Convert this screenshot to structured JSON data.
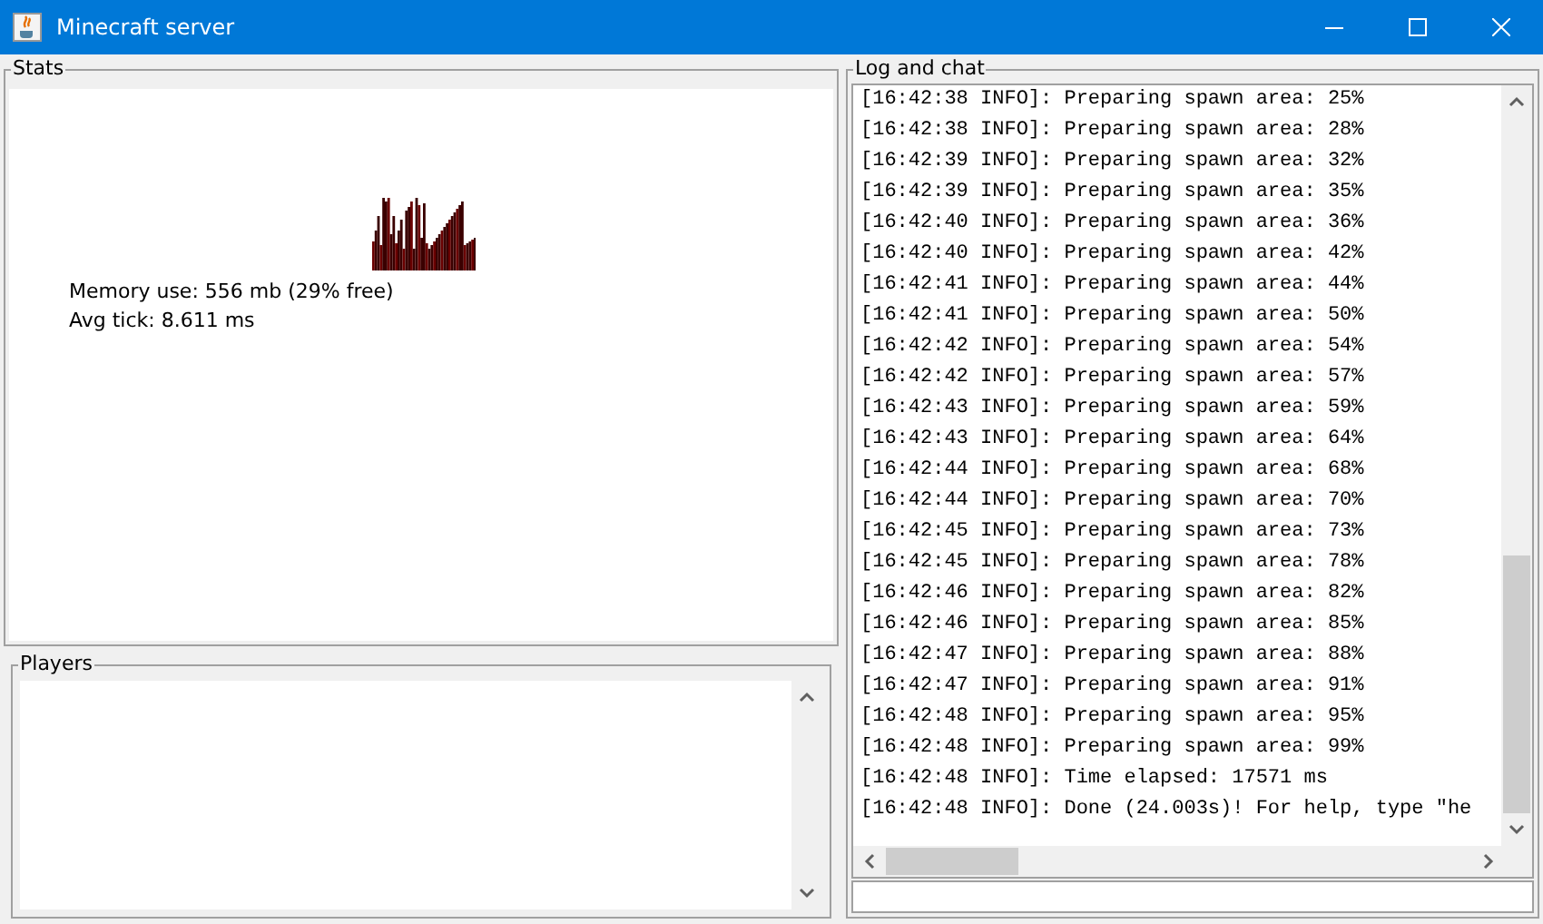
{
  "window": {
    "title": "Minecraft server"
  },
  "stats": {
    "title": "Stats",
    "memory": "Memory use: 556 mb (29% free)",
    "tick": "Avg tick: 8.611 ms"
  },
  "players": {
    "title": "Players"
  },
  "log": {
    "title": "Log and chat",
    "lines": [
      "[16:42:38 INFO]: Preparing spawn area: 25%",
      "[16:42:38 INFO]: Preparing spawn area: 28%",
      "[16:42:39 INFO]: Preparing spawn area: 32%",
      "[16:42:39 INFO]: Preparing spawn area: 35%",
      "[16:42:40 INFO]: Preparing spawn area: 36%",
      "[16:42:40 INFO]: Preparing spawn area: 42%",
      "[16:42:41 INFO]: Preparing spawn area: 44%",
      "[16:42:41 INFO]: Preparing spawn area: 50%",
      "[16:42:42 INFO]: Preparing spawn area: 54%",
      "[16:42:42 INFO]: Preparing spawn area: 57%",
      "[16:42:43 INFO]: Preparing spawn area: 59%",
      "[16:42:43 INFO]: Preparing spawn area: 64%",
      "[16:42:44 INFO]: Preparing spawn area: 68%",
      "[16:42:44 INFO]: Preparing spawn area: 70%",
      "[16:42:45 INFO]: Preparing spawn area: 73%",
      "[16:42:45 INFO]: Preparing spawn area: 78%",
      "[16:42:46 INFO]: Preparing spawn area: 82%",
      "[16:42:46 INFO]: Preparing spawn area: 85%",
      "[16:42:47 INFO]: Preparing spawn area: 88%",
      "[16:42:47 INFO]: Preparing spawn area: 91%",
      "[16:42:48 INFO]: Preparing spawn area: 95%",
      "[16:42:48 INFO]: Preparing spawn area: 99%",
      "[16:42:48 INFO]: Time elapsed: 17571 ms",
      "[16:42:48 INFO]: Done (24.003s)! For help, type \"he"
    ]
  }
}
